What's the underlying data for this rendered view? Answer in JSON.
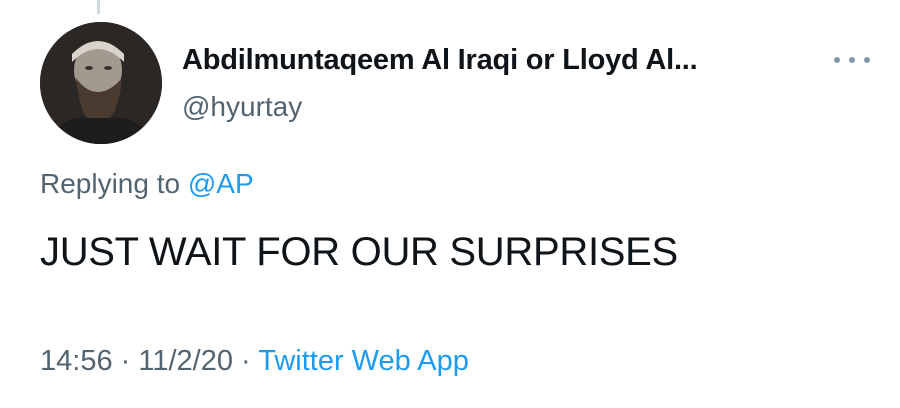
{
  "tweet": {
    "author": {
      "display_name": "Abdilmuntaqeem Al Iraqi or Lloyd Al...",
      "handle": "@hyurtay"
    },
    "more_icon": "more-horizontal-icon",
    "reply": {
      "prefix": "Replying to ",
      "mention": "@AP"
    },
    "text": "JUST WAIT FOR OUR SURPRISES",
    "meta": {
      "time": "14:56",
      "separator1": " · ",
      "date": "11/2/20",
      "separator2": " · ",
      "source": "Twitter Web App"
    }
  },
  "colors": {
    "text_primary": "#0f1419",
    "text_secondary": "#536471",
    "link_blue": "#1d9bf0"
  }
}
